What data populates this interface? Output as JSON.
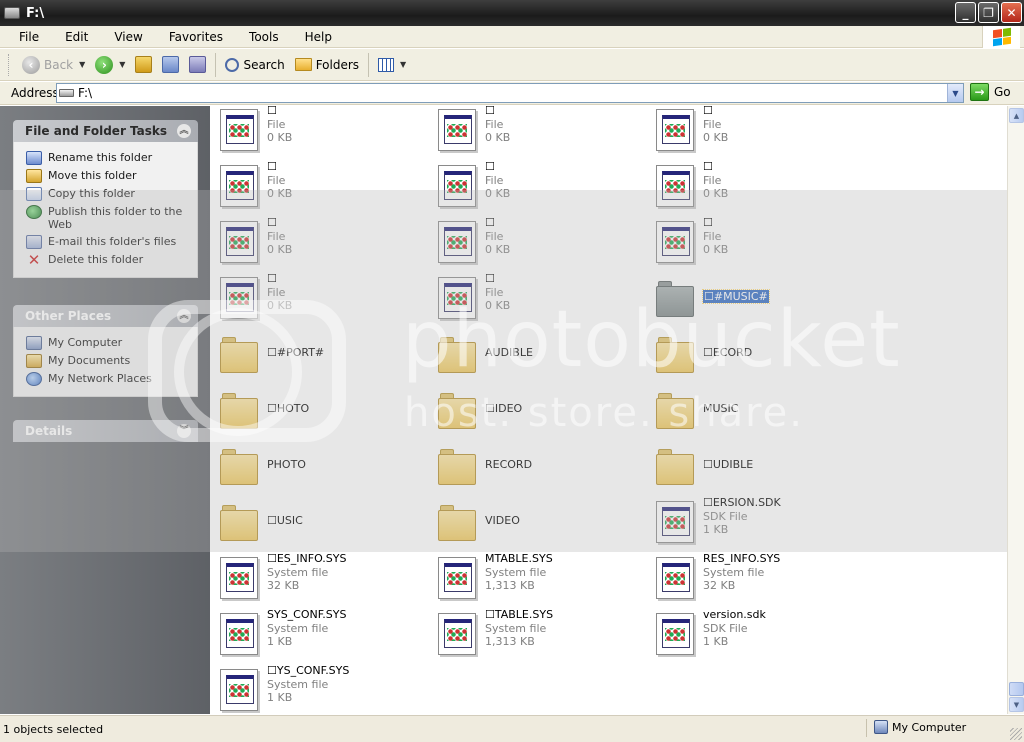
{
  "window": {
    "title": "F:\\",
    "buttons": {
      "minimize": "_",
      "maximize": "❐",
      "close": "✕"
    }
  },
  "menu": [
    {
      "label": "File"
    },
    {
      "label": "Edit"
    },
    {
      "label": "View"
    },
    {
      "label": "Favorites"
    },
    {
      "label": "Tools"
    },
    {
      "label": "Help"
    }
  ],
  "toolbar": {
    "back": "Back",
    "search": "Search",
    "folders": "Folders"
  },
  "address": {
    "label": "Address",
    "value": "F:\\",
    "go": "Go"
  },
  "left_pane": {
    "file_tasks": {
      "title": "File and Folder Tasks",
      "items": [
        {
          "label": "Rename this folder",
          "icon": "rename-icon"
        },
        {
          "label": "Move this folder",
          "icon": "move-folder-icon"
        },
        {
          "label": "Copy this folder",
          "icon": "copy-folder-icon"
        },
        {
          "label": "Publish this folder to the Web",
          "icon": "publish-web-icon"
        },
        {
          "label": "E-mail this folder's files",
          "icon": "email-icon"
        },
        {
          "label": "Delete this folder",
          "icon": "delete-icon"
        }
      ]
    },
    "other_places": {
      "title": "Other Places",
      "items": [
        {
          "label": "My Computer",
          "icon": "my-computer-icon"
        },
        {
          "label": "My Documents",
          "icon": "my-documents-icon"
        },
        {
          "label": "My Network Places",
          "icon": "network-places-icon"
        }
      ]
    },
    "details": {
      "title": "Details"
    }
  },
  "items": [
    {
      "name": "☐",
      "type": "File",
      "size": "0 KB",
      "kind": "file"
    },
    {
      "name": "☐",
      "type": "File",
      "size": "0 KB",
      "kind": "file"
    },
    {
      "name": "☐",
      "type": "File",
      "size": "0 KB",
      "kind": "file"
    },
    {
      "name": "☐",
      "type": "File",
      "size": "0 KB",
      "kind": "file"
    },
    {
      "name": "☐",
      "type": "File",
      "size": "0 KB",
      "kind": "file"
    },
    {
      "name": "☐",
      "type": "File",
      "size": "0 KB",
      "kind": "file"
    },
    {
      "name": "☐",
      "type": "File",
      "size": "0 KB",
      "kind": "file"
    },
    {
      "name": "☐",
      "type": "File",
      "size": "0 KB",
      "kind": "file"
    },
    {
      "name": "☐",
      "type": "File",
      "size": "0 KB",
      "kind": "file"
    },
    {
      "name": "☐",
      "type": "File",
      "size": "0 KB",
      "kind": "file"
    },
    {
      "name": "☐",
      "type": "File",
      "size": "0 KB",
      "kind": "file"
    },
    {
      "name": "☐#MUSIC#",
      "kind": "folder",
      "selected": true
    },
    {
      "name": "☐#PORT#",
      "kind": "folder"
    },
    {
      "name": "AUDIBLE",
      "kind": "folder"
    },
    {
      "name": "☐ECORD",
      "kind": "folder"
    },
    {
      "name": "☐HOTO",
      "kind": "folder"
    },
    {
      "name": "☐IDEO",
      "kind": "folder"
    },
    {
      "name": "MUSIC",
      "kind": "folder"
    },
    {
      "name": "PHOTO",
      "kind": "folder"
    },
    {
      "name": "RECORD",
      "kind": "folder"
    },
    {
      "name": "☐UDIBLE",
      "kind": "folder"
    },
    {
      "name": "☐USIC",
      "kind": "folder"
    },
    {
      "name": "VIDEO",
      "kind": "folder"
    },
    {
      "name": "☐ERSION.SDK",
      "type": "SDK File",
      "size": "1 KB",
      "kind": "file"
    },
    {
      "name": "☐ES_INFO.SYS",
      "type": "System file",
      "size": "32 KB",
      "kind": "file"
    },
    {
      "name": "MTABLE.SYS",
      "type": "System file",
      "size": "1,313 KB",
      "kind": "file"
    },
    {
      "name": "RES_INFO.SYS",
      "type": "System file",
      "size": "32 KB",
      "kind": "file"
    },
    {
      "name": "SYS_CONF.SYS",
      "type": "System file",
      "size": "1 KB",
      "kind": "file"
    },
    {
      "name": "☐TABLE.SYS",
      "type": "System file",
      "size": "1,313 KB",
      "kind": "file"
    },
    {
      "name": "version.sdk",
      "type": "SDK File",
      "size": "1 KB",
      "kind": "file"
    },
    {
      "name": "☐YS_CONF.SYS",
      "type": "System file",
      "size": "1 KB",
      "kind": "file"
    }
  ],
  "watermark": {
    "line1": "photobucket",
    "line2": "host. store. share."
  },
  "status": {
    "left": "1 objects selected",
    "right": "My Computer"
  }
}
